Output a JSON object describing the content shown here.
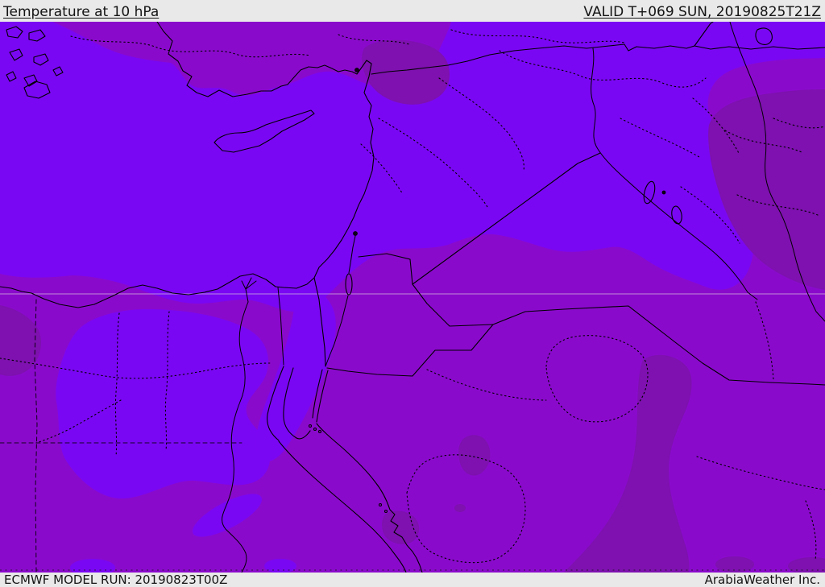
{
  "header": {
    "title": "Temperature at 10 hPa",
    "valid_label": "VALID T+069 SUN, 20190825T21Z"
  },
  "footer": {
    "model_run_label": "ECMWF MODEL RUN: 20190823T00Z",
    "credit_label": "ArabiaWeather Inc."
  },
  "palette": {
    "violet": "#7a07f3",
    "purple": "#8a0acc",
    "dark_purple": "#7e11af",
    "bar_bg": "#e9e9e9",
    "bar_text": "#141414",
    "line": "#000000",
    "gridline": "#d8d2de"
  },
  "map": {
    "shades": [
      {
        "name": "warm-violet-band",
        "hex": "#7a07f3"
      },
      {
        "name": "mid-purple-band",
        "hex": "#8a0acc"
      },
      {
        "name": "coolest-dark-purple-band",
        "hex": "#7e11af"
      }
    ]
  }
}
